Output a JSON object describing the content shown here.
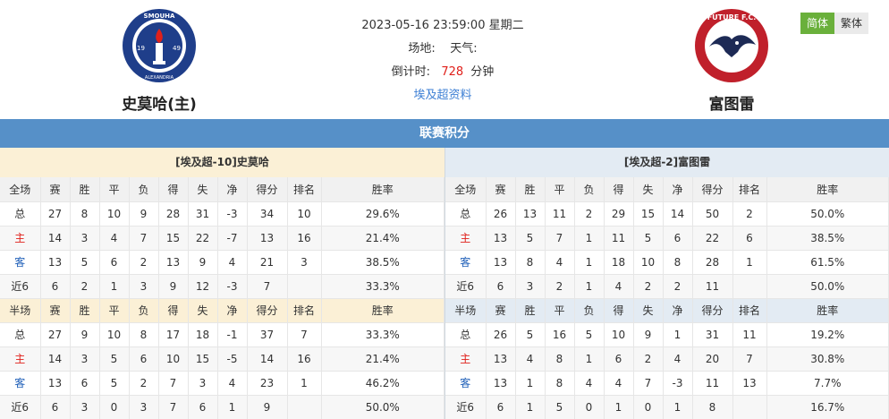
{
  "home": {
    "name": "史莫哈(主)",
    "logo_text_top": "SMOUHA",
    "logo_text_bottom": "ALEXANDRIA",
    "logo_year_left": "19",
    "logo_year_right": "49"
  },
  "away": {
    "name": "富图雷",
    "logo_text": "FUTURE F.C."
  },
  "match": {
    "datetime": "2023-05-16 23:59:00 星期二",
    "venue_label": "场地:",
    "weather_label": "天气:",
    "countdown_label": "倒计时:",
    "countdown_value": "728",
    "countdown_unit": "分钟",
    "league_link": "埃及超资料"
  },
  "lang": {
    "simplified": "简体",
    "traditional": "繁体"
  },
  "section_title": "联赛积分",
  "columns_full": [
    "全场",
    "赛",
    "胜",
    "平",
    "负",
    "得",
    "失",
    "净",
    "得分",
    "排名",
    "胜率"
  ],
  "columns_half": [
    "半场",
    "赛",
    "胜",
    "平",
    "负",
    "得",
    "失",
    "净",
    "得分",
    "排名",
    "胜率"
  ],
  "left": {
    "team_bar": "[埃及超-10]史莫哈",
    "full": [
      [
        "总",
        "27",
        "8",
        "10",
        "9",
        "28",
        "31",
        "-3",
        "34",
        "10",
        "29.6%"
      ],
      [
        "主",
        "14",
        "3",
        "4",
        "7",
        "15",
        "22",
        "-7",
        "13",
        "16",
        "21.4%"
      ],
      [
        "客",
        "13",
        "5",
        "6",
        "2",
        "13",
        "9",
        "4",
        "21",
        "3",
        "38.5%"
      ],
      [
        "近6",
        "6",
        "2",
        "1",
        "3",
        "9",
        "12",
        "-3",
        "7",
        "",
        "33.3%"
      ]
    ],
    "half": [
      [
        "总",
        "27",
        "9",
        "10",
        "8",
        "17",
        "18",
        "-1",
        "37",
        "7",
        "33.3%"
      ],
      [
        "主",
        "14",
        "3",
        "5",
        "6",
        "10",
        "15",
        "-5",
        "14",
        "16",
        "21.4%"
      ],
      [
        "客",
        "13",
        "6",
        "5",
        "2",
        "7",
        "3",
        "4",
        "23",
        "1",
        "46.2%"
      ],
      [
        "近6",
        "6",
        "3",
        "0",
        "3",
        "7",
        "6",
        "1",
        "9",
        "",
        "50.0%"
      ]
    ]
  },
  "right": {
    "team_bar": "[埃及超-2]富图雷",
    "full": [
      [
        "总",
        "26",
        "13",
        "11",
        "2",
        "29",
        "15",
        "14",
        "50",
        "2",
        "50.0%"
      ],
      [
        "主",
        "13",
        "5",
        "7",
        "1",
        "11",
        "5",
        "6",
        "22",
        "6",
        "38.5%"
      ],
      [
        "客",
        "13",
        "8",
        "4",
        "1",
        "18",
        "10",
        "8",
        "28",
        "1",
        "61.5%"
      ],
      [
        "近6",
        "6",
        "3",
        "2",
        "1",
        "4",
        "2",
        "2",
        "11",
        "",
        "50.0%"
      ]
    ],
    "half": [
      [
        "总",
        "26",
        "5",
        "16",
        "5",
        "10",
        "9",
        "1",
        "31",
        "11",
        "19.2%"
      ],
      [
        "主",
        "13",
        "4",
        "8",
        "1",
        "6",
        "2",
        "4",
        "20",
        "7",
        "30.8%"
      ],
      [
        "客",
        "13",
        "1",
        "8",
        "4",
        "4",
        "7",
        "-3",
        "11",
        "13",
        "7.7%"
      ],
      [
        "近6",
        "6",
        "1",
        "5",
        "0",
        "1",
        "0",
        "1",
        "8",
        "",
        "16.7%"
      ]
    ]
  },
  "colors": {
    "header_blue": "#5690c8",
    "home_red": "#e0201b",
    "away_blue": "#1f5fb8",
    "lang_green": "#6ab03b"
  }
}
